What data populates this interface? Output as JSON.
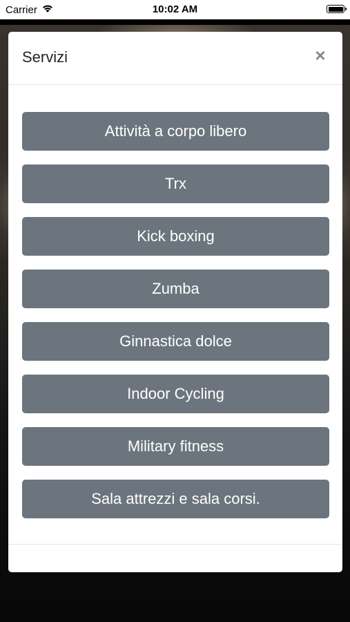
{
  "status_bar": {
    "carrier": "Carrier",
    "time": "10:02 AM"
  },
  "modal": {
    "title": "Servizi",
    "close_label": "×",
    "services": [
      "Attività a corpo libero",
      "Trx",
      "Kick boxing",
      "Zumba",
      "Ginnastica dolce",
      "Indoor Cycling",
      "Military fitness",
      "Sala attrezzi e sala corsi."
    ]
  },
  "colors": {
    "button_bg": "#6c757d",
    "button_text": "#ffffff"
  }
}
